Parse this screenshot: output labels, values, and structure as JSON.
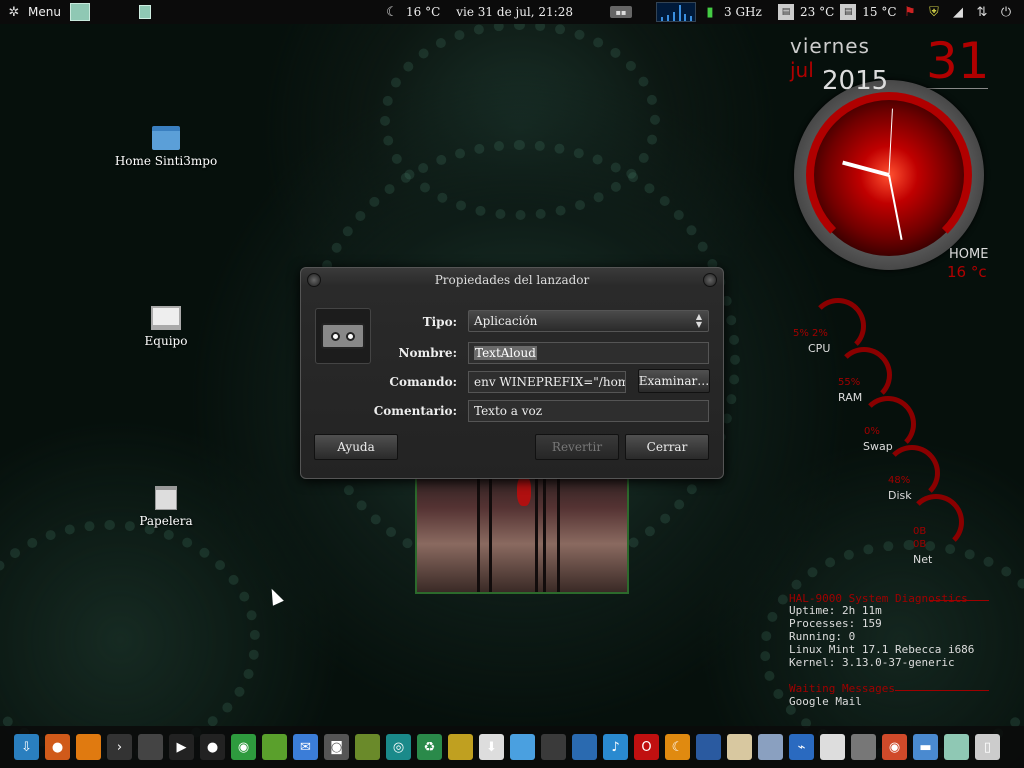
{
  "top_panel": {
    "menu_label": "Menu",
    "weather_temp": "16 °C",
    "datetime": "vie 31 de jul, 21:28",
    "cpu_freq": "3 GHz",
    "temp1": "23 °C",
    "temp2": "15 °C"
  },
  "desktop_icons": [
    {
      "label": "Home Sinti3mpo"
    },
    {
      "label": "Equipo"
    },
    {
      "label": "Papelera"
    }
  ],
  "conky": {
    "day_name": "viernes",
    "month": "jul",
    "year": "2015",
    "day": "31",
    "home_label": "HOME",
    "home_temp": "16 °c",
    "cpu_values": "5%   2%",
    "cpu_label": "CPU",
    "ram_value": "55%",
    "ram_label": "RAM",
    "swap_value": "0%",
    "swap_label": "Swap",
    "disk_value": "48%",
    "disk_label": "Disk",
    "net_up": "0B",
    "net_down": "0B",
    "net_label": "Net",
    "diag_title": "HAL-9000 System Diagnostics",
    "uptime": "Uptime: 2h 11m",
    "processes": "Processes: 159",
    "running": "Running: 0",
    "os": "Linux Mint 17.1 Rebecca  i686",
    "kernel": "Kernel: 3.13.0-37-generic",
    "waiting_title": "Waiting Messages",
    "mail": "Google Mail"
  },
  "dialog": {
    "title": "Propiedades del lanzador",
    "tipo_label": "Tipo:",
    "tipo_value": "Aplicación",
    "nombre_label": "Nombre:",
    "nombre_value": "TextAloud",
    "comando_label": "Comando:",
    "comando_value": "env WINEPREFIX=\"/home/",
    "examinar_label": "Examinar…",
    "comentario_label": "Comentario:",
    "comentario_value": "Texto a voz",
    "ayuda_label": "Ayuda",
    "revertir_label": "Revertir",
    "cerrar_label": "Cerrar"
  },
  "dock_items": [
    {
      "icon": "download-icon",
      "color": "#2a7fbf"
    },
    {
      "icon": "firefox-icon",
      "color": "#d05a1a"
    },
    {
      "icon": "app-orange-icon",
      "color": "#e07a10"
    },
    {
      "icon": "terminal-icon",
      "color": "#333333"
    },
    {
      "icon": "calculator-icon",
      "color": "#444444"
    },
    {
      "icon": "media-player-icon",
      "color": "#222222"
    },
    {
      "icon": "record-icon",
      "color": "#222222"
    },
    {
      "icon": "chrome-icon",
      "color": "#2e9b3e"
    },
    {
      "icon": "install-icon",
      "color": "#5aa02c"
    },
    {
      "icon": "mail-icon",
      "color": "#3b7dd8"
    },
    {
      "icon": "camera-icon",
      "color": "#555555"
    },
    {
      "icon": "lamp-icon",
      "color": "#6a8a2a"
    },
    {
      "icon": "disc-icon",
      "color": "#1a8a8a"
    },
    {
      "icon": "recycle-icon",
      "color": "#2a8a4a"
    },
    {
      "icon": "palette-icon",
      "color": "#c0a020"
    },
    {
      "icon": "save-down-icon",
      "color": "#dddddd"
    },
    {
      "icon": "files-icon",
      "color": "#4aa0e0"
    },
    {
      "icon": "monitor-icon",
      "color": "#3a3a3a"
    },
    {
      "icon": "window-icon",
      "color": "#2a6ab0"
    },
    {
      "icon": "music-icon",
      "color": "#2a8ad0"
    },
    {
      "icon": "opera-icon",
      "color": "#c01010"
    },
    {
      "icon": "moon-icon",
      "color": "#e08a10"
    },
    {
      "icon": "book-icon",
      "color": "#2a5aa0"
    },
    {
      "icon": "document-icon",
      "color": "#d8c8a0"
    },
    {
      "icon": "display-icon",
      "color": "#8aa0c0"
    },
    {
      "icon": "usb-icon",
      "color": "#2a6ac0"
    },
    {
      "icon": "package-icon",
      "color": "#dddddd"
    },
    {
      "icon": "cassette-icon",
      "color": "#777777"
    },
    {
      "icon": "chrome2-icon",
      "color": "#d04a2a"
    },
    {
      "icon": "folder-icon",
      "color": "#4a8ad0"
    },
    {
      "icon": "spreadsheet-icon",
      "color": "#8fc8b4"
    },
    {
      "icon": "trash-icon",
      "color": "#cccccc"
    }
  ]
}
